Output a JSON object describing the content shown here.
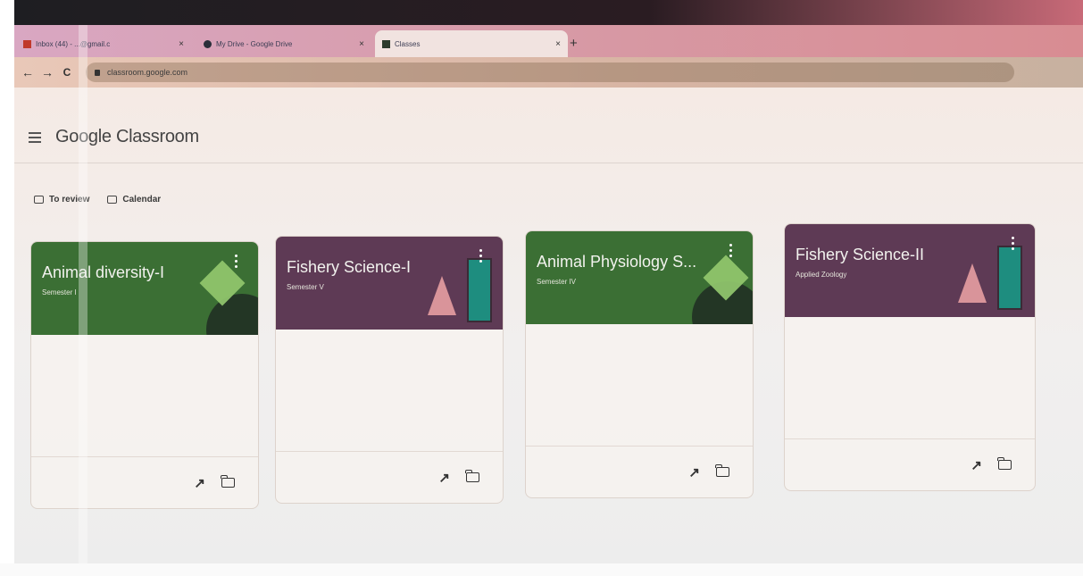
{
  "browser": {
    "tabs": [
      {
        "label": "Inbox (44) - ...@gmail.c",
        "icon": "mail-icon",
        "close": "×"
      },
      {
        "label": "My Drive - Google Drive",
        "icon": "drive-icon",
        "close": "×"
      },
      {
        "label": "Classes",
        "icon": "classroom-icon",
        "close": "×",
        "active": true
      }
    ],
    "new_tab": "+",
    "nav": {
      "back": "←",
      "forward": "→",
      "reload": "C"
    },
    "url": "classroom.google.com"
  },
  "header": {
    "logo_text": "Google Classroom"
  },
  "toolbar": {
    "to_review": "To review",
    "calendar": "Calendar"
  },
  "classes": [
    {
      "title": "Animal diversity-I",
      "subtitle": "Semester I",
      "theme": "green",
      "color": "#3b6f34"
    },
    {
      "title": "Fishery Science-I",
      "subtitle": "Semester V",
      "theme": "purple",
      "color": "#5e3a55"
    },
    {
      "title": "Animal Physiology S...",
      "subtitle": "Semester IV",
      "theme": "green",
      "color": "#3b6f34"
    },
    {
      "title": "Fishery Science-II",
      "subtitle": "Applied Zoology",
      "theme": "purple",
      "color": "#5e3a55"
    }
  ],
  "card_actions": {
    "progress": "↗",
    "folder": "folder-icon"
  }
}
